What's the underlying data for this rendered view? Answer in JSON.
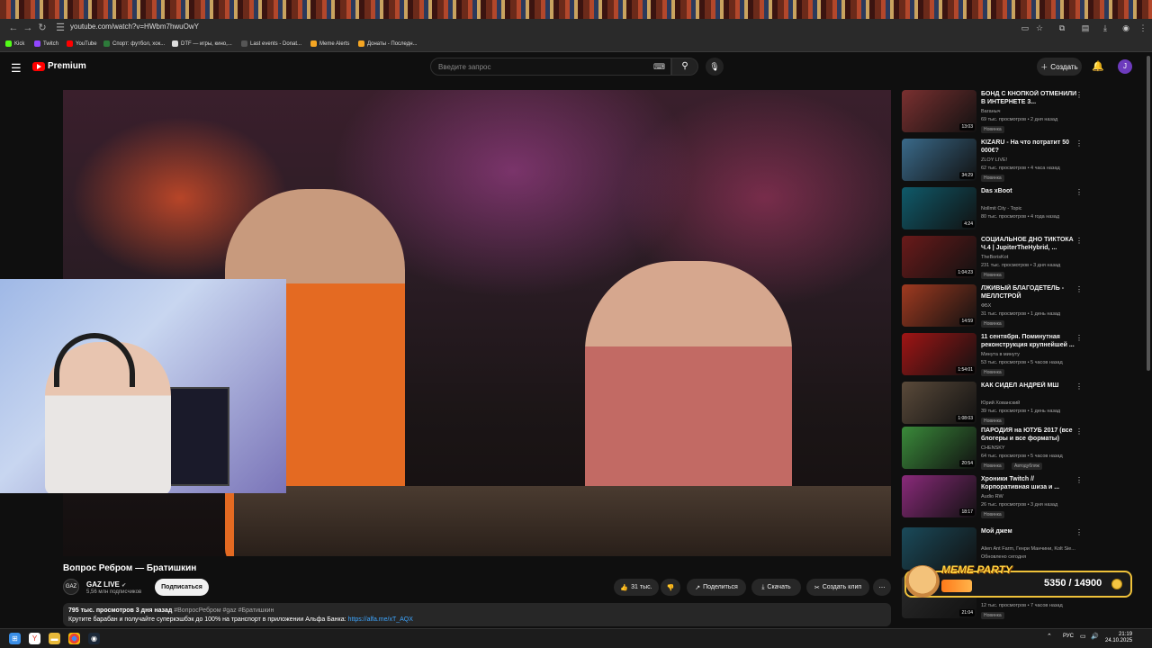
{
  "browser": {
    "url": "youtube.com/watch?v=HWbm7hwuOwY",
    "bookmarks": [
      {
        "label": "Kick",
        "color": "#53fc18"
      },
      {
        "label": "Twitch",
        "color": "#9146ff"
      },
      {
        "label": "YouTube",
        "color": "#ff0000"
      },
      {
        "label": "Спорт: футбол, хок...",
        "color": "#2d7a3a"
      },
      {
        "label": "DTF — игры, кино,...",
        "color": "#dddddd"
      },
      {
        "label": "Last events - Donat...",
        "color": "#555555"
      },
      {
        "label": "Meme Alerts",
        "color": "#f5a623"
      },
      {
        "label": "Донаты - Последн...",
        "color": "#f5a623"
      }
    ]
  },
  "header": {
    "logo_text": "Premium",
    "search_placeholder": "Введите запрос",
    "create_label": "Создать",
    "avatar_letter": "J"
  },
  "video": {
    "title": "Вопрос Ребром — Братишкин",
    "channel_name": "GAZ LIVE",
    "channel_avatar": "GAZ",
    "subscribers": "5,56 млн подписчиков",
    "subscribe_label": "Подписаться",
    "likes": "31 тыс.",
    "share_label": "Поделиться",
    "download_label": "Скачать",
    "clip_label": "Создать клип",
    "views_date": "795 тыс. просмотров  3 дня назад",
    "tags": "#ВопросРебром #gaz #Братишкин",
    "description": "Крутите барабан и получайте суперкэшбэк до 100% на транспорт в приложении Альфа Банка:",
    "description_link": "https://alfa.me/xT_AQX"
  },
  "recommendations": [
    {
      "title": "БОНД С КНОПКОЙ ОТМЕНИЛИ В ИНТЕРНЕТЕ 3...",
      "channel": "Ваганыч",
      "meta": "69 тыс. просмотров • 2 дня назад",
      "badge": "Новинка",
      "duration": "13:03",
      "color": "#7a3030"
    },
    {
      "title": "KIZARU - На что потратит 50 000€?",
      "channel": "ZLOY LIVE!",
      "meta": "62 тыс. просмотров • 4 часа назад",
      "badge": "Новинка",
      "duration": "34:29",
      "color": "#3a6a8a"
    },
    {
      "title": "Das xBoot",
      "channel": "Nollmit City - Topic",
      "meta": "80 тыс. просмотров • 4 года назад",
      "badge": "",
      "duration": "4:24",
      "color": "#0f5a6a"
    },
    {
      "title": "СОЦИАЛЬНОЕ ДНО ТИКТОКА Ч.4 | JupiterTheHybrid, ...",
      "channel": "TheBorisKot",
      "meta": "231 тыс. просмотров • 3 дня назад",
      "badge": "Новинка",
      "duration": "1:04:23",
      "color": "#6a1a1a"
    },
    {
      "title": "ЛЖИВЫЙ БЛАГОДЕТЕЛЬ - МЕЛЛСТРОЙ",
      "channel": "ФБХ",
      "meta": "31 тыс. просмотров • 1 день назад",
      "badge": "Новинка",
      "duration": "14:59",
      "color": "#a03a20"
    },
    {
      "title": "11 сентября. Поминутная реконструкция крупнейшей ...",
      "channel": "Минута в минуту",
      "meta": "53 тыс. просмотров • 5 часов назад",
      "badge": "Новинка",
      "duration": "1:54:01",
      "color": "#a01515"
    },
    {
      "title": "КАК СИДЕЛ АНДРЕЙ МШ",
      "channel": "Юрий Хованский",
      "meta": "39 тыс. просмотров • 1 день назад",
      "badge": "Новинка",
      "duration": "1:08:03",
      "color": "#5a4a3a"
    },
    {
      "title": "ПАРОДИЯ на ЮТУБ 2017 (все блогеры и все форматы)",
      "channel": "CHENSKY",
      "meta": "64 тыс. просмотров • 5 часов назад",
      "badge": "Новинка",
      "badge2": "Автодубляж",
      "duration": "20:54",
      "color": "#3a8a3a"
    },
    {
      "title": "Хроники Twitch // Корпоративная шиза и ...",
      "channel": "Audio RW",
      "meta": "26 тыс. просмотров • 3 дня назад",
      "badge": "Новинка",
      "duration": "18:17",
      "color": "#8a2a7a"
    },
    {
      "title": "Мой джем",
      "channel": "Alien Ant Farm, Генри Манчини, Kolt Sie...",
      "meta": "Обновлено сегодня",
      "badge": "",
      "duration": "",
      "color": "#1a4a5a"
    },
    {
      "title": "",
      "channel": "",
      "meta": "12 тыс. просмотров • 7 часов назад",
      "badge": "Новинка",
      "duration": "21:04",
      "color": "#2a2a2a"
    }
  ],
  "overlay": {
    "title": "MEME PARTY",
    "progress_current": 5350,
    "progress_total": 14900,
    "count_text": "5350 / 14900"
  },
  "taskbar": {
    "lang": "РУС",
    "time": "21:19",
    "date": "24.10.2025"
  }
}
